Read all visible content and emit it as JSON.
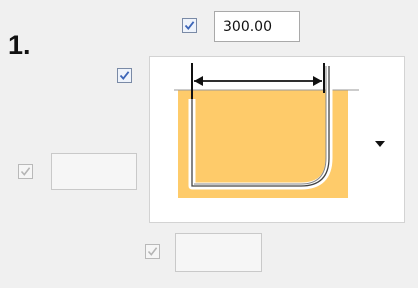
{
  "step": {
    "label": "1."
  },
  "controls": {
    "top_checkbox": {
      "checked": true,
      "enabled": true
    },
    "top_value": "300.00",
    "shape_checkbox": {
      "checked": true,
      "enabled": true
    },
    "left_checkbox": {
      "checked": true,
      "enabled": false
    },
    "left_value": "",
    "bottom_checkbox": {
      "checked": true,
      "enabled": false
    },
    "bottom_value": ""
  },
  "shape_selector": {
    "icon": "bend-profile-icon"
  },
  "colors": {
    "fill": "#fecb6a",
    "accent": "#3c65b8"
  }
}
